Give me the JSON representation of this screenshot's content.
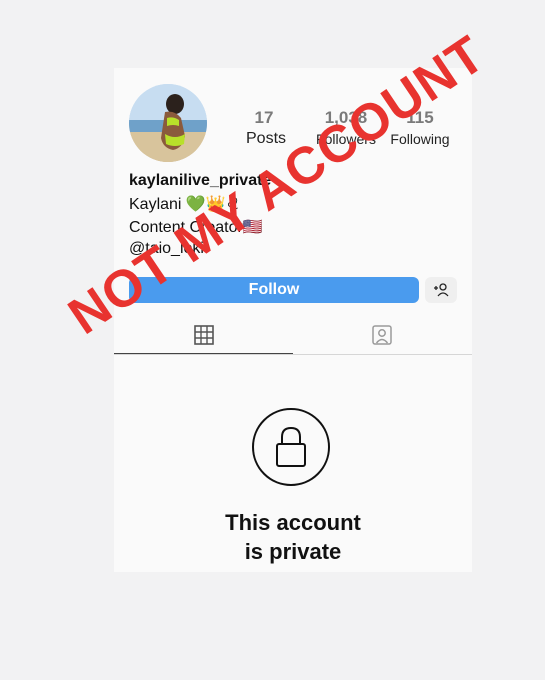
{
  "profile": {
    "username": "kaylanilive_private",
    "stats": {
      "posts_count": "17",
      "posts_label": "Posts",
      "followers_count": "1,038",
      "followers_label": "Followers",
      "following_count": "115",
      "following_label": "Following"
    },
    "bio": {
      "name": "Kaylani 💚👑♌",
      "title": "Content Creator🇺🇸",
      "mention": "@taio_loki"
    },
    "follow_label": "Follow",
    "suggest_icon": "add-person-icon"
  },
  "tabs": [
    {
      "icon": "grid-icon"
    },
    {
      "icon": "tagged-person-icon"
    }
  ],
  "private_notice": {
    "icon": "lock-icon",
    "line1": "This account",
    "line2": "is private"
  },
  "overlay": {
    "stamp_text": "NOT MY ACCOUNT",
    "stamp_color": "#e8332f"
  },
  "colors": {
    "follow_button": "#4a9bee",
    "background": "#f2f2f3",
    "card": "#fafafa"
  }
}
